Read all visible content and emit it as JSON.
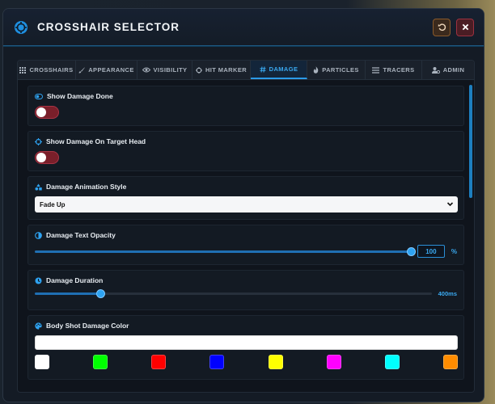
{
  "window": {
    "title": "CROSSHAIR SELECTOR",
    "title_icon": "crosshair-icon",
    "reset_icon": "undo-icon",
    "close_icon": "close-icon"
  },
  "tabs": [
    {
      "label": "CROSSHAIRS",
      "icon": "grid-icon"
    },
    {
      "label": "APPEARANCE",
      "icon": "brush-icon"
    },
    {
      "label": "VISIBILITY",
      "icon": "eye-icon"
    },
    {
      "label": "HIT MARKER",
      "icon": "target-icon"
    },
    {
      "label": "DAMAGE",
      "icon": "hash-icon",
      "active": true
    },
    {
      "label": "PARTICLES",
      "icon": "fire-icon"
    },
    {
      "label": "TRACERS",
      "icon": "lines-icon"
    },
    {
      "label": "ADMIN",
      "icon": "user-gear-icon"
    }
  ],
  "settings": {
    "show_damage_done": {
      "label": "Show Damage Done",
      "enabled": false
    },
    "show_damage_head": {
      "label": "Show Damage On Target Head",
      "enabled": false
    },
    "animation_style": {
      "label": "Damage Animation Style",
      "value": "Fade Up"
    },
    "text_opacity": {
      "label": "Damage Text Opacity",
      "value": "100",
      "unit": "%",
      "fraction": 1.0
    },
    "duration": {
      "label": "Damage Duration",
      "value": "400ms",
      "fraction": 0.165
    },
    "body_color": {
      "label": "Body Shot Damage Color",
      "current": "#ffffff",
      "swatches": [
        "#ffffff",
        "#00ff00",
        "#ff0000",
        "#0000ff",
        "#ffff00",
        "#ff00ff",
        "#00ffff",
        "#ff8c00"
      ]
    }
  },
  "colors": {
    "accent": "#2b9ae8",
    "toggle_off": "#7a1f2a"
  }
}
